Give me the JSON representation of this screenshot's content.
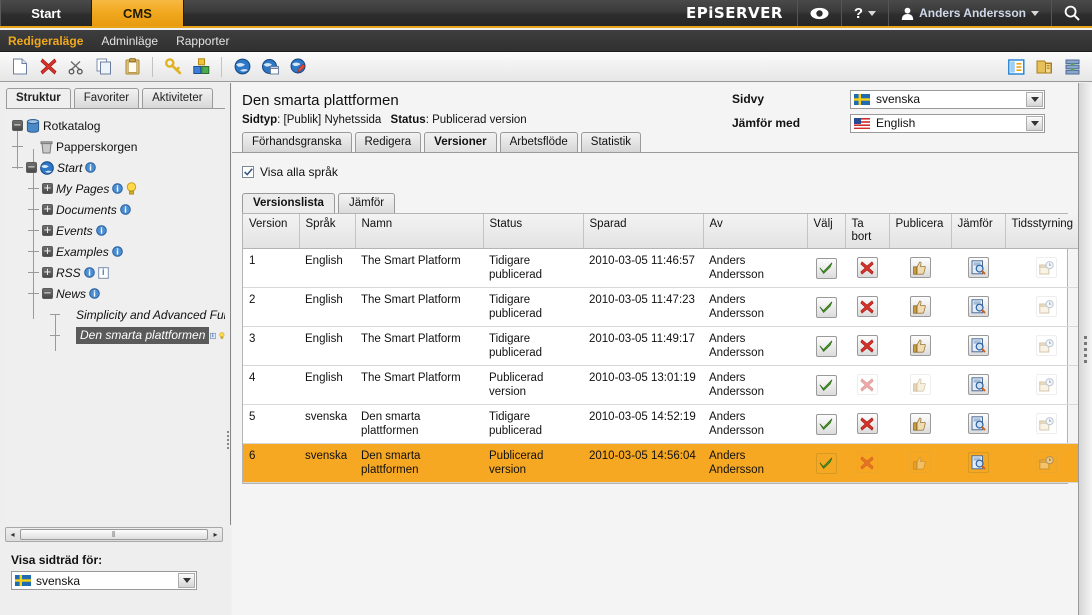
{
  "globalbar": {
    "tabs": [
      {
        "label": "Start",
        "active": false
      },
      {
        "label": "CMS",
        "active": true
      }
    ],
    "brand": "EPiSERVER",
    "eye_icon": "eye-icon",
    "help_icon": "question-mark-icon",
    "user_icon": "person-icon",
    "username": "Anders Andersson",
    "search_icon": "search-icon"
  },
  "modebar": {
    "items": [
      {
        "label": "Redigeraläge",
        "active": true
      },
      {
        "label": "Adminläge",
        "active": false
      },
      {
        "label": "Rapporter",
        "active": false
      }
    ]
  },
  "toolbar": {
    "left_icons": [
      "new-page-icon",
      "delete-icon",
      "cut-icon",
      "copy-icon",
      "paste-icon",
      "key-icon",
      "package-icon",
      "globe-icon",
      "globe-window-icon",
      "globe-edit-icon"
    ],
    "right_icons": [
      "panel-layout-icon",
      "gadget-folder-icon",
      "server-stack-icon"
    ]
  },
  "left_panel": {
    "tabs": [
      {
        "label": "Struktur",
        "active": true
      },
      {
        "label": "Favoriter",
        "active": false
      },
      {
        "label": "Aktiviteter",
        "active": false
      }
    ],
    "tree": [
      {
        "label": "Rotkatalog",
        "toggle": "minus",
        "indent": 0,
        "icon": "database-icon",
        "italic": false,
        "badges": [],
        "selected": false
      },
      {
        "label": "Papperskorgen",
        "toggle": "none",
        "indent": 1,
        "icon": "trash-icon",
        "italic": false,
        "badges": [],
        "selected": false
      },
      {
        "label": "Start",
        "toggle": "minus",
        "indent": 1,
        "icon": "globe-icon",
        "italic": true,
        "badges": [
          "info"
        ],
        "selected": false
      },
      {
        "label": "My Pages",
        "toggle": "plus",
        "indent": 2,
        "icon": "none",
        "italic": true,
        "badges": [
          "info",
          "bulb"
        ],
        "selected": false
      },
      {
        "label": "Documents",
        "toggle": "plus",
        "indent": 2,
        "icon": "none",
        "italic": true,
        "badges": [
          "info"
        ],
        "selected": false
      },
      {
        "label": "Events",
        "toggle": "plus",
        "indent": 2,
        "icon": "none",
        "italic": true,
        "badges": [
          "info"
        ],
        "selected": false
      },
      {
        "label": "Examples",
        "toggle": "plus",
        "indent": 2,
        "icon": "none",
        "italic": true,
        "badges": [
          "info"
        ],
        "selected": false
      },
      {
        "label": "RSS",
        "toggle": "plus",
        "indent": 2,
        "icon": "none",
        "italic": true,
        "badges": [
          "info",
          "doc"
        ],
        "selected": false
      },
      {
        "label": "News",
        "toggle": "minus",
        "indent": 2,
        "icon": "none",
        "italic": true,
        "badges": [
          "info"
        ],
        "selected": false
      },
      {
        "label": "Simplicity and Advanced Fun",
        "toggle": "none",
        "indent": 3,
        "icon": "none",
        "italic": true,
        "badges": [],
        "selected": false
      },
      {
        "label": "Den smarta plattformen",
        "toggle": "none",
        "indent": 3,
        "icon": "none",
        "italic": true,
        "badges": [
          "doc",
          "bulb"
        ],
        "selected": true
      }
    ],
    "scroll": {
      "left_arrow": "◂",
      "right_arrow": "▸",
      "grip": "‖"
    },
    "sidtree_label": "Visa sidträd för:",
    "sidtree_value": "svenska",
    "sidtree_flag": "swedish-flag"
  },
  "page": {
    "title": "Den smarta plattformen",
    "meta_label_type": "Sidtyp",
    "meta_value_type": "[Publik] Nyhetssida",
    "meta_label_status": "Status",
    "meta_value_status": "Publicerad version",
    "sidvy_label": "Sidvy",
    "sidvy_value": "svenska",
    "sidvy_flag": "swedish-flag",
    "jamfor_label": "Jämför med",
    "jamfor_value": "English",
    "jamfor_flag": "us-flag",
    "tabs": [
      {
        "label": "Förhandsgranska",
        "active": false
      },
      {
        "label": "Redigera",
        "active": false
      },
      {
        "label": "Versioner",
        "active": true
      },
      {
        "label": "Arbetsflöde",
        "active": false
      },
      {
        "label": "Statistik",
        "active": false
      }
    ],
    "show_all_languages": "Visa alla språk",
    "show_all_languages_checked": true,
    "subtabs": [
      {
        "label": "Versionslista",
        "active": true
      },
      {
        "label": "Jämför",
        "active": false
      }
    ]
  },
  "table": {
    "columns": [
      "Version",
      "Språk",
      "Namn",
      "Status",
      "Sparad",
      "Av",
      "Välj",
      "Ta bort",
      "Publicera",
      "Jämför",
      "Tidsstyrning"
    ],
    "rows": [
      {
        "version": "1",
        "sprak": "English",
        "namn": "The Smart Platform",
        "status": "Tidigare publicerad",
        "sparad": "2010-03-05 11:46:57",
        "av": "Anders Andersson",
        "valj": "enabled",
        "tabort": "enabled",
        "publicera": "enabled",
        "jamfor": "enabled",
        "tidsstyrning": "disabled",
        "highlight": false
      },
      {
        "version": "2",
        "sprak": "English",
        "namn": "The Smart Platform",
        "status": "Tidigare publicerad",
        "sparad": "2010-03-05 11:47:23",
        "av": "Anders Andersson",
        "valj": "enabled",
        "tabort": "enabled",
        "publicera": "enabled",
        "jamfor": "enabled",
        "tidsstyrning": "disabled",
        "highlight": false
      },
      {
        "version": "3",
        "sprak": "English",
        "namn": "The Smart Platform",
        "status": "Tidigare publicerad",
        "sparad": "2010-03-05 11:49:17",
        "av": "Anders Andersson",
        "valj": "enabled",
        "tabort": "enabled",
        "publicera": "enabled",
        "jamfor": "enabled",
        "tidsstyrning": "disabled",
        "highlight": false
      },
      {
        "version": "4",
        "sprak": "English",
        "namn": "The Smart Platform",
        "status": "Publicerad version",
        "sparad": "2010-03-05 13:01:19",
        "av": "Anders Andersson",
        "valj": "enabled",
        "tabort": "disabled",
        "publicera": "disabled",
        "jamfor": "enabled",
        "tidsstyrning": "disabled",
        "highlight": false
      },
      {
        "version": "5",
        "sprak": "svenska",
        "namn": "Den smarta plattformen",
        "status": "Tidigare publicerad",
        "sparad": "2010-03-05 14:52:19",
        "av": "Anders Andersson",
        "valj": "enabled",
        "tabort": "enabled",
        "publicera": "enabled",
        "jamfor": "enabled",
        "tidsstyrning": "disabled",
        "highlight": false
      },
      {
        "version": "6",
        "sprak": "svenska",
        "namn": "Den smarta plattformen",
        "status": "Publicerad version",
        "sparad": "2010-03-05 14:56:04",
        "av": "Anders Andersson",
        "valj": "enabled",
        "tabort": "disabled",
        "publicera": "disabled",
        "jamfor": "enabled",
        "tidsstyrning": "disabled",
        "highlight": true
      }
    ]
  },
  "colors": {
    "accent": "#f0a81e",
    "highlight_row": "#F7A823",
    "dark_bar": "#2e2e2e"
  }
}
